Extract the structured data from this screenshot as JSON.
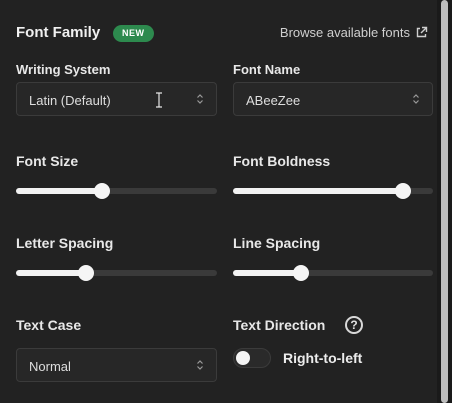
{
  "header": {
    "title": "Font Family",
    "badge": "NEW",
    "browse_link": "Browse available fonts",
    "browse_icon": "external-link-icon"
  },
  "writing_system": {
    "label": "Writing System",
    "value": "Latin (Default)"
  },
  "font_name": {
    "label": "Font Name",
    "value": "ABeeZee"
  },
  "font_size": {
    "label": "Font Size",
    "level_percent": 43
  },
  "font_boldness": {
    "label": "Font Boldness",
    "level_percent": 85
  },
  "letter_spacing": {
    "label": "Letter Spacing",
    "level_percent": 35
  },
  "line_spacing": {
    "label": "Line Spacing",
    "level_percent": 34
  },
  "text_case": {
    "label": "Text Case",
    "value": "Normal"
  },
  "text_direction": {
    "label": "Text Direction",
    "help_icon": "question-circle-icon",
    "toggle_label": "Right-to-left",
    "toggle_on": false
  },
  "colors": {
    "badge_green": "#2d8a4e",
    "background": "#222222",
    "slider_fill": "#f2f2f2",
    "slider_track": "#3a3a3a"
  }
}
